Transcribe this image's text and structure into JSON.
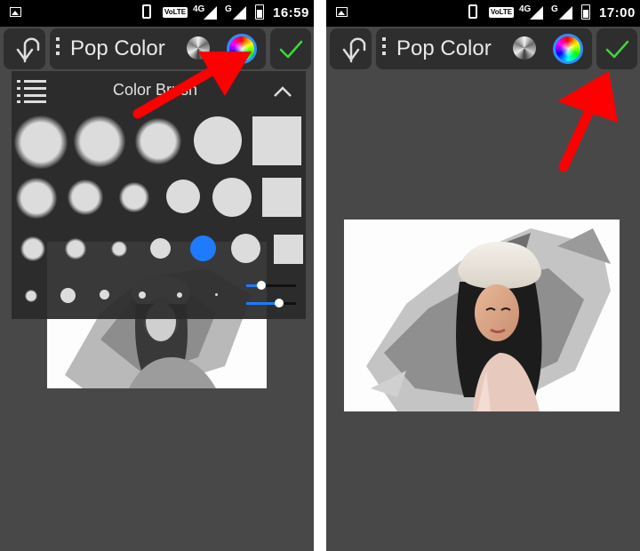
{
  "status_bar": {
    "volte": "VoLTE",
    "network": "4G",
    "network2": "G"
  },
  "left_screen": {
    "status_time": "16:59",
    "tool_title": "Pop Color",
    "brush_panel": {
      "title": "Color Brush",
      "size_slider": 0.3,
      "opacity_slider": 0.66
    }
  },
  "right_screen": {
    "status_time": "17:00",
    "tool_title": "Pop Color"
  },
  "colors": {
    "accent": "#1e7bff",
    "confirm": "#3cd93c",
    "annotation_arrow": "#ff0000",
    "toolbar_bg": "#2e2e2e",
    "canvas_bg": "#484848"
  },
  "icons": [
    "undo-icon",
    "menu-dots-icon",
    "grayscale-mode-icon",
    "color-mode-icon",
    "checkmark-icon",
    "list-icon",
    "chevron-up-icon",
    "gallery-icon",
    "vibrate-icon",
    "signal-icon",
    "battery-icon"
  ]
}
